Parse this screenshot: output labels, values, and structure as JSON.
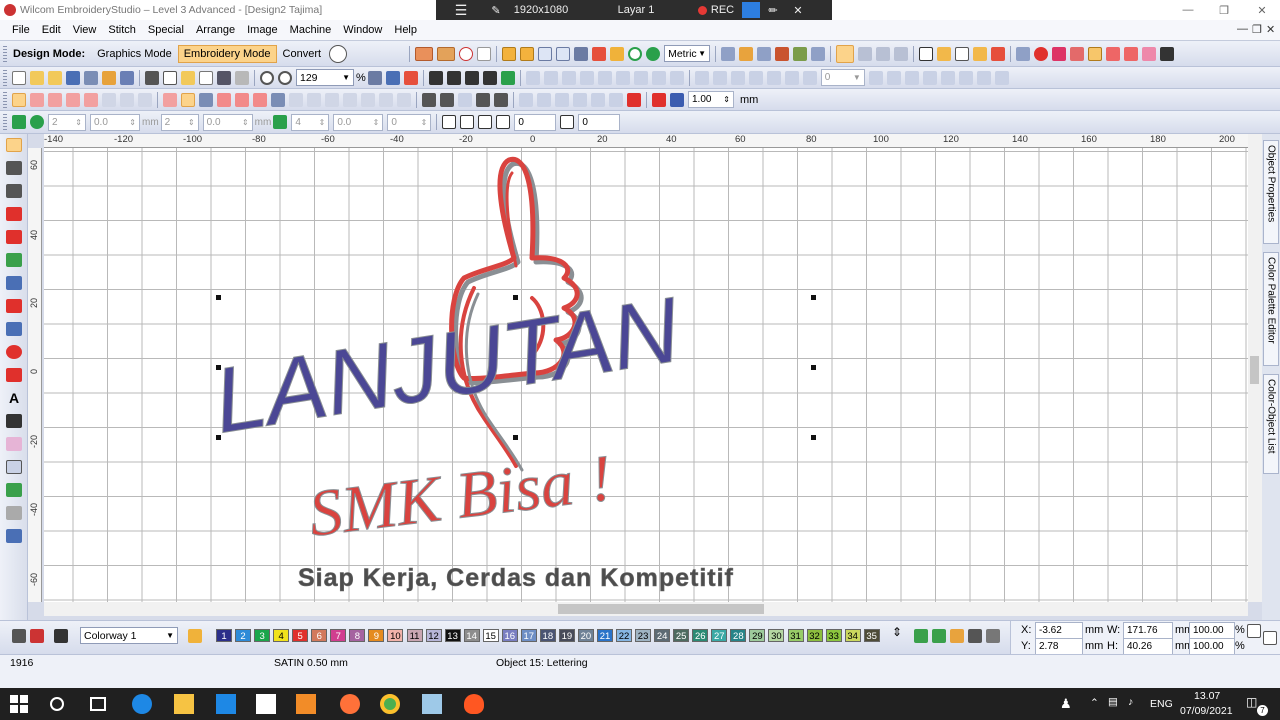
{
  "titlebar": {
    "app_title": "Wilcom EmbroideryStudio – Level 3 Advanced - [Design2     Tajima]"
  },
  "recorder": {
    "resolution": "1920x1080",
    "layer": "Layar 1",
    "rec": "REC"
  },
  "menu": [
    "File",
    "Edit",
    "View",
    "Stitch",
    "Special",
    "Arrange",
    "Image",
    "Machine",
    "Window",
    "Help"
  ],
  "design_mode": {
    "label": "Design Mode:",
    "graphics": "Graphics Mode",
    "embroidery": "Embroidery Mode",
    "convert": "Convert"
  },
  "units_combo": "Metric",
  "zoom_value": "129",
  "zoom_unit": "%",
  "size_value": "1.00",
  "size_unit": "mm",
  "toolbar4": {
    "v1": "2",
    "v2": "0.0",
    "v3": "2",
    "v4": "0.0",
    "v5": "4",
    "v6": "0.0",
    "v7": "0",
    "v8": "0",
    "v9": "0",
    "unit": "mm"
  },
  "ruler_top": [
    "-140",
    "-120",
    "-100",
    "-80",
    "-60",
    "-40",
    "-20",
    "0",
    "20",
    "40",
    "60",
    "80",
    "100",
    "120",
    "140",
    "160",
    "180",
    "200"
  ],
  "ruler_left": [
    "60",
    "40",
    "20",
    "0",
    "-20",
    "-40",
    "-60"
  ],
  "design": {
    "line1": "LANJUTAN",
    "line2": "SMK Bisa !",
    "line3": "Siap Kerja, Cerdas dan Kompetitif"
  },
  "docker_tabs": [
    "Object Properties",
    "Color Palette Editor",
    "Color-Object List"
  ],
  "colorway": "Colorway 1",
  "swatches": [
    {
      "n": "1",
      "c": "#2b2f8a",
      "t": "#fff"
    },
    {
      "n": "2",
      "c": "#2e8bd8",
      "t": "#fff"
    },
    {
      "n": "3",
      "c": "#1aa64b",
      "t": "#fff"
    },
    {
      "n": "4",
      "c": "#f1e21c",
      "t": "#000"
    },
    {
      "n": "5",
      "c": "#e0302c",
      "t": "#fff"
    },
    {
      "n": "6",
      "c": "#d2795c",
      "t": "#fff"
    },
    {
      "n": "7",
      "c": "#d13e8f",
      "t": "#fff"
    },
    {
      "n": "8",
      "c": "#a563a0",
      "t": "#fff"
    },
    {
      "n": "9",
      "c": "#e58b1f",
      "t": "#fff"
    },
    {
      "n": "10",
      "c": "#f2b3aa",
      "t": "#000"
    },
    {
      "n": "11",
      "c": "#c9a6b2",
      "t": "#000"
    },
    {
      "n": "12",
      "c": "#b7b6d8",
      "t": "#000"
    },
    {
      "n": "13",
      "c": "#111111",
      "t": "#fff"
    },
    {
      "n": "14",
      "c": "#8d8d8d",
      "t": "#fff"
    },
    {
      "n": "15",
      "c": "#ffffff",
      "t": "#000"
    },
    {
      "n": "16",
      "c": "#7a7ec2",
      "t": "#fff"
    },
    {
      "n": "17",
      "c": "#6e8fc6",
      "t": "#fff"
    },
    {
      "n": "18",
      "c": "#4a5473",
      "t": "#fff"
    },
    {
      "n": "19",
      "c": "#474b5a",
      "t": "#fff"
    },
    {
      "n": "20",
      "c": "#6f8296",
      "t": "#fff"
    },
    {
      "n": "21",
      "c": "#2a73c9",
      "t": "#fff"
    },
    {
      "n": "22",
      "c": "#86b6e2",
      "t": "#000"
    },
    {
      "n": "23",
      "c": "#9fb4c3",
      "t": "#000"
    },
    {
      "n": "24",
      "c": "#5d6b74",
      "t": "#fff"
    },
    {
      "n": "25",
      "c": "#4d6b60",
      "t": "#fff"
    },
    {
      "n": "26",
      "c": "#2a8a74",
      "t": "#fff"
    },
    {
      "n": "27",
      "c": "#3aa9a5",
      "t": "#fff"
    },
    {
      "n": "28",
      "c": "#278489",
      "t": "#fff"
    },
    {
      "n": "29",
      "c": "#9ecb9c",
      "t": "#000"
    },
    {
      "n": "30",
      "c": "#b5d6a2",
      "t": "#000"
    },
    {
      "n": "31",
      "c": "#97cc67",
      "t": "#000"
    },
    {
      "n": "32",
      "c": "#8cbe3e",
      "t": "#000"
    },
    {
      "n": "33",
      "c": "#8cc63e",
      "t": "#000"
    },
    {
      "n": "34",
      "c": "#cbd85e",
      "t": "#000"
    },
    {
      "n": "35",
      "c": "#4e4c38",
      "t": "#fff"
    }
  ],
  "coords": {
    "x_label": "X:",
    "x": "-3.62",
    "y_label": "Y:",
    "y": "2.78",
    "w_label": "W:",
    "w": "171.76",
    "h_label": "H:",
    "h": "40.26",
    "unit": "mm",
    "sx": "100.00",
    "sy": "100.00",
    "pct": "%"
  },
  "status": {
    "stitches": "1916",
    "stitch_type": "SATIN  0.50 mm",
    "object": "Object 15: Lettering"
  },
  "taskbar": {
    "lang": "ENG",
    "time": "13.07",
    "date": "07/09/2021",
    "badge": "7"
  }
}
